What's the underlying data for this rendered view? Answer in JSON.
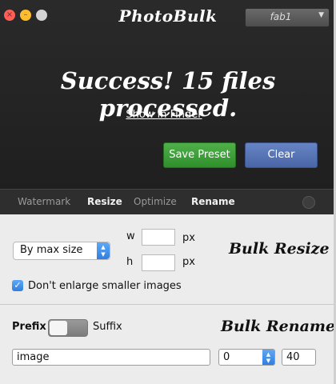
{
  "window": {
    "title": "PhotoBulk",
    "preset": {
      "selected": "fab1"
    }
  },
  "status": {
    "message": "Success! 15 files processed.",
    "link": "Show in Finder"
  },
  "buttons": {
    "save_preset": "Save Preset",
    "clear": "Clear"
  },
  "tabs": [
    {
      "label": "Watermark",
      "active": false
    },
    {
      "label": "Resize",
      "active": true
    },
    {
      "label": "Optimize",
      "active": false
    },
    {
      "label": "Rename",
      "active": true
    }
  ],
  "resize": {
    "mode": "By max size",
    "w_label": "w",
    "h_label": "h",
    "w_value": "",
    "h_value": "",
    "unit": "px",
    "dont_enlarge": "Don't enlarge smaller images",
    "dont_enlarge_checked": true,
    "section_title": "Bulk Resize"
  },
  "rename": {
    "prefix_label": "Prefix",
    "suffix_label": "Suffix",
    "section_title": "Bulk Rename",
    "name_value": "image",
    "start_value": "0",
    "count_value": "40"
  },
  "colors": {
    "save_button": "#3a9b35",
    "clear_button": "#5572b4",
    "accent_blue": "#2f7fe0"
  }
}
